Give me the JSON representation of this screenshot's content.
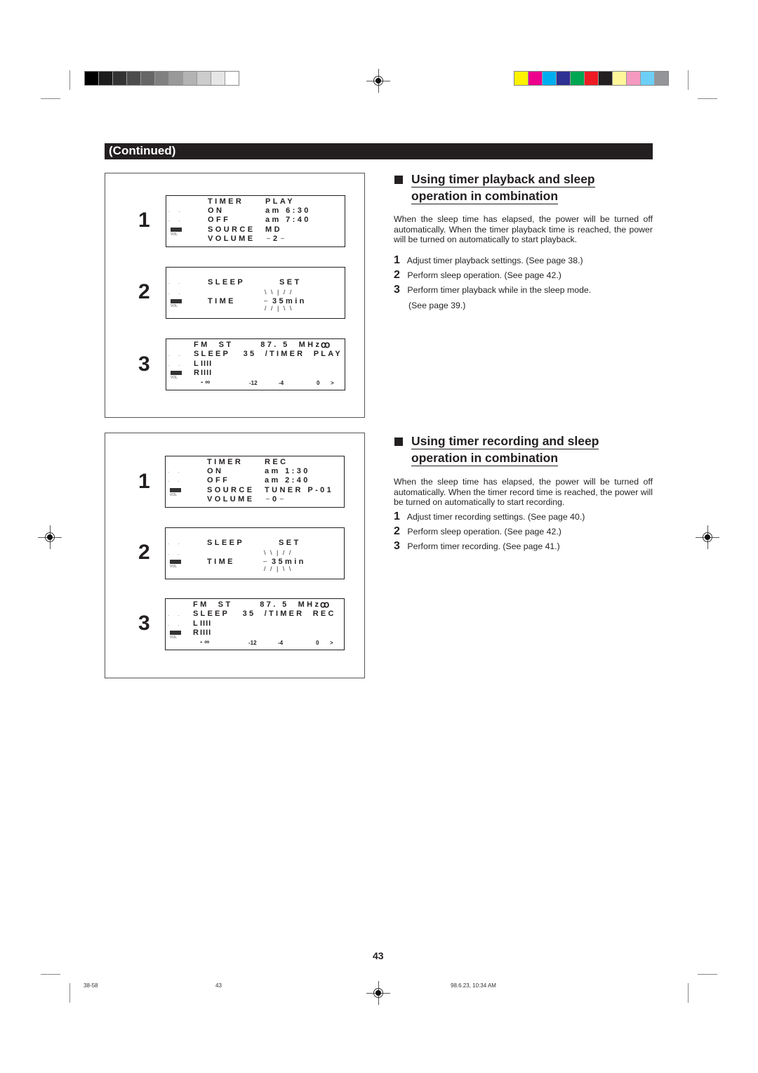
{
  "registration": {
    "grayscale": [
      "#000000",
      "#1c1c1c",
      "#333333",
      "#4d4d4d",
      "#666666",
      "#808080",
      "#999999",
      "#b3b3b3",
      "#cccccc",
      "#e6e6e6",
      "#ffffff"
    ],
    "colors": [
      "#fff200",
      "#ec008c",
      "#00aeef",
      "#2e3192",
      "#00a651",
      "#ed1c24",
      "#231f20",
      "#fff799",
      "#f49ac1",
      "#6dcff6",
      "#939598"
    ]
  },
  "header": {
    "continued_label": "(Continued)"
  },
  "playback_figure": {
    "steps": [
      {
        "number": "1",
        "rows": [
          {
            "label": "TIMER",
            "value": "PLAY"
          },
          {
            "label": "ON",
            "value": "am 6:30"
          },
          {
            "label": "OFF",
            "value": "am 7:40"
          },
          {
            "label": "SOURCE",
            "value": "MD"
          },
          {
            "label": "VOLUME",
            "value": "2"
          }
        ]
      },
      {
        "number": "2",
        "rows": [
          {
            "label": "SLEEP",
            "value": "SET"
          },
          {
            "label": "TIME",
            "value": "35min"
          }
        ]
      },
      {
        "number": "3",
        "line1": "FM  ST      87. 5  MHz",
        "line2": "SLEEP   35  /TIMER  PLAY",
        "left_channel": "L",
        "right_channel": "R",
        "meter_labels": [
          "- ∞",
          "-12",
          "-4",
          "0",
          ">"
        ]
      }
    ]
  },
  "recording_figure": {
    "steps": [
      {
        "number": "1",
        "rows": [
          {
            "label": "TIMER",
            "value": "REC"
          },
          {
            "label": "ON",
            "value": "am 1:30"
          },
          {
            "label": "OFF",
            "value": "am 2:40"
          },
          {
            "label": "SOURCE",
            "value": "TUNER P-01"
          },
          {
            "label": "VOLUME",
            "value": "0"
          }
        ]
      },
      {
        "number": "2",
        "rows": [
          {
            "label": "SLEEP",
            "value": "SET"
          },
          {
            "label": "TIME",
            "value": "35min"
          }
        ]
      },
      {
        "number": "3",
        "line1": "FM  ST      87. 5  MHz",
        "line2": "SLEEP   35  /TIMER  REC",
        "left_channel": "L",
        "right_channel": "R",
        "meter_labels": [
          "- ∞",
          "-12",
          "-4",
          "0",
          ">"
        ]
      }
    ]
  },
  "lcd_common": {
    "vol_label": "VOL"
  },
  "playback_section": {
    "title_line1": "Using timer playback and sleep",
    "title_line2": "operation in combination",
    "body": "When the sleep time has elapsed, the power will be turned off automatically. When the timer playback time is reached, the power will be turned on automatically to start playback.",
    "steps": [
      {
        "number": "1",
        "text": "Adjust timer playback settings. (See page 38.)"
      },
      {
        "number": "2",
        "text": "Perform sleep operation. (See page 42.)"
      },
      {
        "number": "3",
        "text": "Perform timer playback while in the sleep mode."
      }
    ],
    "step3_continued": "(See page 39.)"
  },
  "recording_section": {
    "title_line1": "Using timer recording and sleep",
    "title_line2": "operation in combination",
    "body": "When the sleep time has elapsed, the power will be turned off automatically. When the timer record time is reached, the power will be turned on automatically to start recording.",
    "steps": [
      {
        "number": "1",
        "text": "Adjust timer recording settings. (See page 40.)"
      },
      {
        "number": "2",
        "text": "Perform sleep operation. (See page 42.)"
      },
      {
        "number": "3",
        "text": "Perform timer recording. (See page 41.)"
      }
    ]
  },
  "footer": {
    "page_number": "43",
    "slug_left": "38-58",
    "slug_page": "43",
    "slug_date": "98.6.23, 10:34 AM"
  }
}
